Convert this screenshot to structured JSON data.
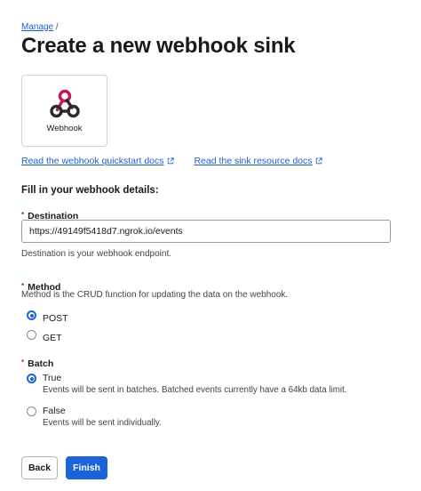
{
  "breadcrumb": {
    "link": "Manage",
    "separator": "/"
  },
  "page_title": "Create a new webhook sink",
  "sink_card": {
    "label": "Webhook",
    "icon": "webhook-icon"
  },
  "doc_links": [
    {
      "label": "Read the webhook quickstart docs",
      "icon": "external-link-icon"
    },
    {
      "label": "Read the sink resource docs",
      "icon": "external-link-icon"
    }
  ],
  "section_heading": "Fill in your webhook details:",
  "destination": {
    "required_mark": "*",
    "label": "Destination",
    "value": "https://49149f5418d7.ngrok.io/events",
    "help": "Destination is your webhook endpoint."
  },
  "method": {
    "required_mark": "*",
    "label": "Method",
    "help": "Method is the CRUD function for updating the data on the webhook.",
    "options": [
      {
        "label": "POST",
        "selected": true
      },
      {
        "label": "GET",
        "selected": false
      }
    ]
  },
  "batch": {
    "required_mark": "*",
    "label": "Batch",
    "options": [
      {
        "label": "True",
        "description": "Events will be sent in batches. Batched events currently have a 64kb data limit.",
        "selected": true
      },
      {
        "label": "False",
        "description": "Events will be sent individually.",
        "selected": false
      }
    ]
  },
  "buttons": {
    "back": "Back",
    "finish": "Finish"
  },
  "colors": {
    "link": "#1f5fd1",
    "primary": "#1a63d9",
    "required": "#d0212e",
    "webhook_icon": "#c2185b"
  }
}
